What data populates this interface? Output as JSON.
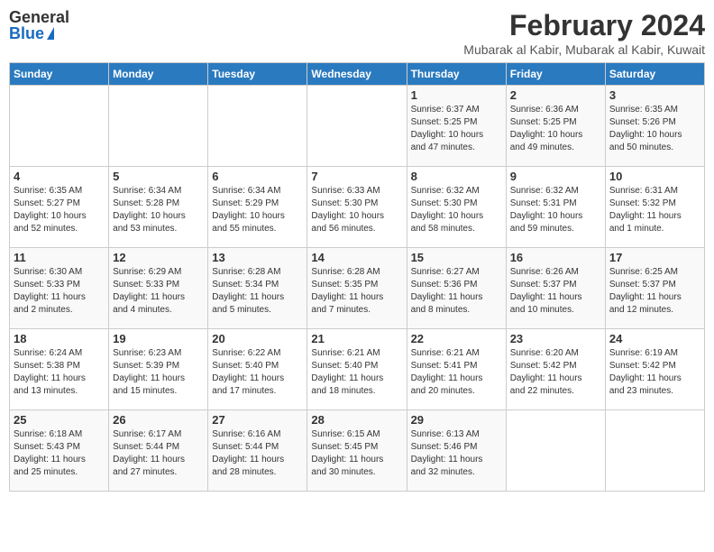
{
  "header": {
    "logo_general": "General",
    "logo_blue": "Blue",
    "month_year": "February 2024",
    "location": "Mubarak al Kabir, Mubarak al Kabir, Kuwait"
  },
  "days_of_week": [
    "Sunday",
    "Monday",
    "Tuesday",
    "Wednesday",
    "Thursday",
    "Friday",
    "Saturday"
  ],
  "weeks": [
    [
      {
        "day": "",
        "lines": []
      },
      {
        "day": "",
        "lines": []
      },
      {
        "day": "",
        "lines": []
      },
      {
        "day": "",
        "lines": []
      },
      {
        "day": "1",
        "lines": [
          "Sunrise: 6:37 AM",
          "Sunset: 5:25 PM",
          "Daylight: 10 hours",
          "and 47 minutes."
        ]
      },
      {
        "day": "2",
        "lines": [
          "Sunrise: 6:36 AM",
          "Sunset: 5:25 PM",
          "Daylight: 10 hours",
          "and 49 minutes."
        ]
      },
      {
        "day": "3",
        "lines": [
          "Sunrise: 6:35 AM",
          "Sunset: 5:26 PM",
          "Daylight: 10 hours",
          "and 50 minutes."
        ]
      }
    ],
    [
      {
        "day": "4",
        "lines": [
          "Sunrise: 6:35 AM",
          "Sunset: 5:27 PM",
          "Daylight: 10 hours",
          "and 52 minutes."
        ]
      },
      {
        "day": "5",
        "lines": [
          "Sunrise: 6:34 AM",
          "Sunset: 5:28 PM",
          "Daylight: 10 hours",
          "and 53 minutes."
        ]
      },
      {
        "day": "6",
        "lines": [
          "Sunrise: 6:34 AM",
          "Sunset: 5:29 PM",
          "Daylight: 10 hours",
          "and 55 minutes."
        ]
      },
      {
        "day": "7",
        "lines": [
          "Sunrise: 6:33 AM",
          "Sunset: 5:30 PM",
          "Daylight: 10 hours",
          "and 56 minutes."
        ]
      },
      {
        "day": "8",
        "lines": [
          "Sunrise: 6:32 AM",
          "Sunset: 5:30 PM",
          "Daylight: 10 hours",
          "and 58 minutes."
        ]
      },
      {
        "day": "9",
        "lines": [
          "Sunrise: 6:32 AM",
          "Sunset: 5:31 PM",
          "Daylight: 10 hours",
          "and 59 minutes."
        ]
      },
      {
        "day": "10",
        "lines": [
          "Sunrise: 6:31 AM",
          "Sunset: 5:32 PM",
          "Daylight: 11 hours",
          "and 1 minute."
        ]
      }
    ],
    [
      {
        "day": "11",
        "lines": [
          "Sunrise: 6:30 AM",
          "Sunset: 5:33 PM",
          "Daylight: 11 hours",
          "and 2 minutes."
        ]
      },
      {
        "day": "12",
        "lines": [
          "Sunrise: 6:29 AM",
          "Sunset: 5:33 PM",
          "Daylight: 11 hours",
          "and 4 minutes."
        ]
      },
      {
        "day": "13",
        "lines": [
          "Sunrise: 6:28 AM",
          "Sunset: 5:34 PM",
          "Daylight: 11 hours",
          "and 5 minutes."
        ]
      },
      {
        "day": "14",
        "lines": [
          "Sunrise: 6:28 AM",
          "Sunset: 5:35 PM",
          "Daylight: 11 hours",
          "and 7 minutes."
        ]
      },
      {
        "day": "15",
        "lines": [
          "Sunrise: 6:27 AM",
          "Sunset: 5:36 PM",
          "Daylight: 11 hours",
          "and 8 minutes."
        ]
      },
      {
        "day": "16",
        "lines": [
          "Sunrise: 6:26 AM",
          "Sunset: 5:37 PM",
          "Daylight: 11 hours",
          "and 10 minutes."
        ]
      },
      {
        "day": "17",
        "lines": [
          "Sunrise: 6:25 AM",
          "Sunset: 5:37 PM",
          "Daylight: 11 hours",
          "and 12 minutes."
        ]
      }
    ],
    [
      {
        "day": "18",
        "lines": [
          "Sunrise: 6:24 AM",
          "Sunset: 5:38 PM",
          "Daylight: 11 hours",
          "and 13 minutes."
        ]
      },
      {
        "day": "19",
        "lines": [
          "Sunrise: 6:23 AM",
          "Sunset: 5:39 PM",
          "Daylight: 11 hours",
          "and 15 minutes."
        ]
      },
      {
        "day": "20",
        "lines": [
          "Sunrise: 6:22 AM",
          "Sunset: 5:40 PM",
          "Daylight: 11 hours",
          "and 17 minutes."
        ]
      },
      {
        "day": "21",
        "lines": [
          "Sunrise: 6:21 AM",
          "Sunset: 5:40 PM",
          "Daylight: 11 hours",
          "and 18 minutes."
        ]
      },
      {
        "day": "22",
        "lines": [
          "Sunrise: 6:21 AM",
          "Sunset: 5:41 PM",
          "Daylight: 11 hours",
          "and 20 minutes."
        ]
      },
      {
        "day": "23",
        "lines": [
          "Sunrise: 6:20 AM",
          "Sunset: 5:42 PM",
          "Daylight: 11 hours",
          "and 22 minutes."
        ]
      },
      {
        "day": "24",
        "lines": [
          "Sunrise: 6:19 AM",
          "Sunset: 5:42 PM",
          "Daylight: 11 hours",
          "and 23 minutes."
        ]
      }
    ],
    [
      {
        "day": "25",
        "lines": [
          "Sunrise: 6:18 AM",
          "Sunset: 5:43 PM",
          "Daylight: 11 hours",
          "and 25 minutes."
        ]
      },
      {
        "day": "26",
        "lines": [
          "Sunrise: 6:17 AM",
          "Sunset: 5:44 PM",
          "Daylight: 11 hours",
          "and 27 minutes."
        ]
      },
      {
        "day": "27",
        "lines": [
          "Sunrise: 6:16 AM",
          "Sunset: 5:44 PM",
          "Daylight: 11 hours",
          "and 28 minutes."
        ]
      },
      {
        "day": "28",
        "lines": [
          "Sunrise: 6:15 AM",
          "Sunset: 5:45 PM",
          "Daylight: 11 hours",
          "and 30 minutes."
        ]
      },
      {
        "day": "29",
        "lines": [
          "Sunrise: 6:13 AM",
          "Sunset: 5:46 PM",
          "Daylight: 11 hours",
          "and 32 minutes."
        ]
      },
      {
        "day": "",
        "lines": []
      },
      {
        "day": "",
        "lines": []
      }
    ]
  ]
}
